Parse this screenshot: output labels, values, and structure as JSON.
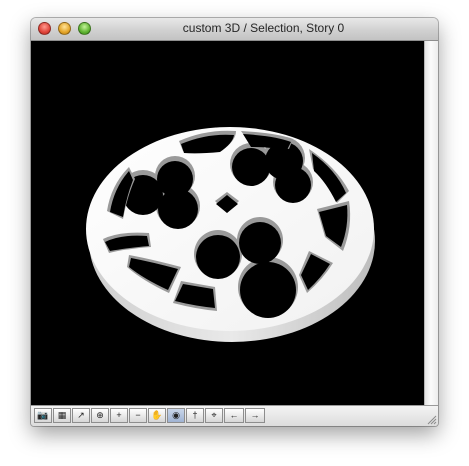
{
  "window": {
    "title": "custom 3D / Selection, Story 0"
  },
  "titlebar_buttons": {
    "close": "close-button",
    "minimize": "minimize-button",
    "zoom": "zoom-button"
  },
  "toolbar": {
    "tools": [
      {
        "name": "camera-settings-icon",
        "glyph": "📷"
      },
      {
        "name": "window-fit-icon",
        "glyph": "▦"
      },
      {
        "name": "view-path-icon",
        "glyph": "↗"
      },
      {
        "name": "zoom-window-icon",
        "glyph": "⊕"
      },
      {
        "name": "zoom-in-icon",
        "glyph": "+"
      },
      {
        "name": "zoom-out-icon",
        "glyph": "−"
      },
      {
        "name": "pan-hand-icon",
        "glyph": "✋"
      },
      {
        "name": "orbit-eye-icon",
        "glyph": "◉"
      },
      {
        "name": "walk-figure-icon",
        "glyph": "†"
      },
      {
        "name": "fit-in-window-icon",
        "glyph": "⌖"
      },
      {
        "name": "previous-zoom-icon",
        "glyph": "←"
      },
      {
        "name": "next-zoom-icon",
        "glyph": "→"
      }
    ],
    "active_tool": "orbit-eye-icon"
  }
}
